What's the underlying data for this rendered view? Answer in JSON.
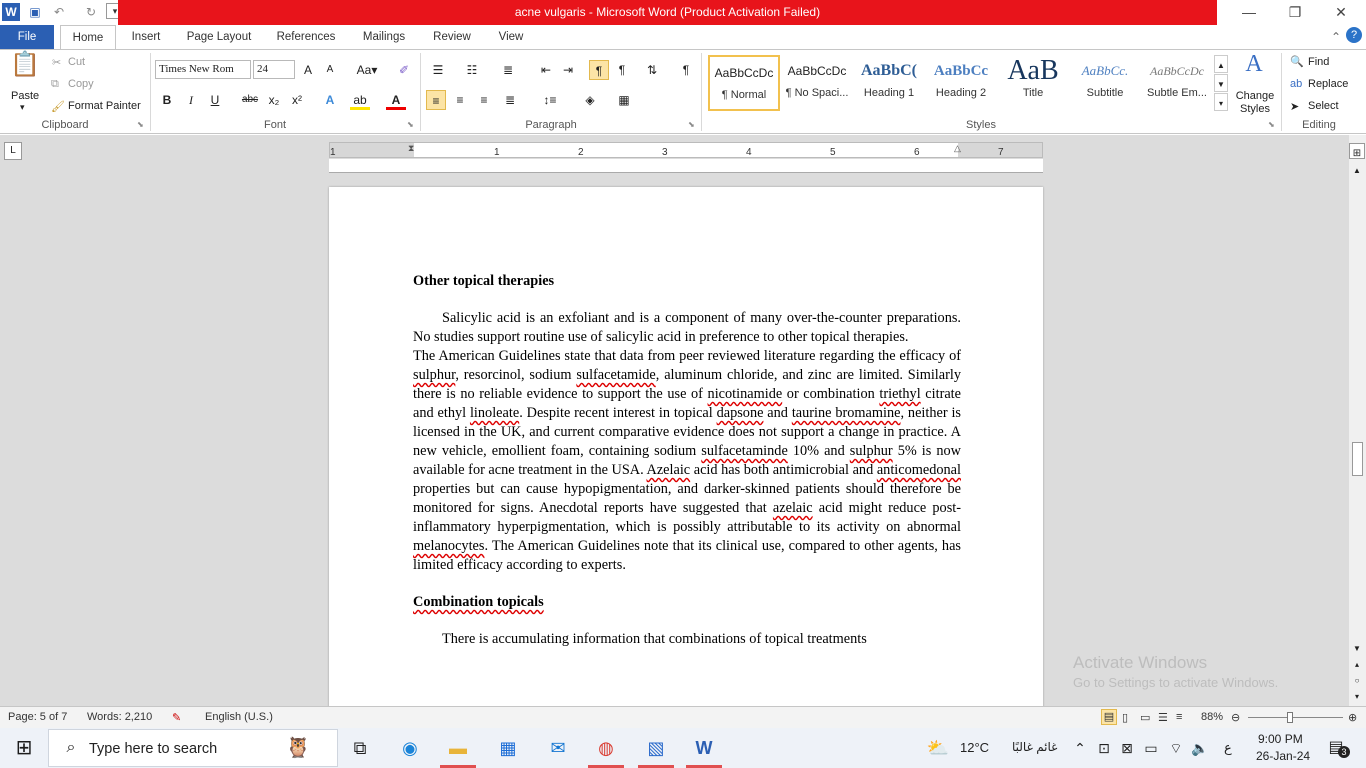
{
  "window": {
    "title": "acne vulgaris  -  Microsoft Word (Product Activation Failed)",
    "minimize": "—",
    "restore": "❐",
    "close": "✕"
  },
  "tabs": [
    "File",
    "Home",
    "Insert",
    "Page Layout",
    "References",
    "Mailings",
    "Review",
    "View"
  ],
  "clipboard": {
    "paste": "Paste",
    "cut": "Cut",
    "copy": "Copy",
    "format_painter": "Format Painter",
    "label": "Clipboard"
  },
  "font": {
    "family": "Times New Rom",
    "size": "24",
    "label": "Font"
  },
  "paragraph": {
    "label": "Paragraph"
  },
  "styles": {
    "label": "Styles",
    "items": [
      {
        "preview": "AaBbCcDc",
        "name": "¶ Normal"
      },
      {
        "preview": "AaBbCcDc",
        "name": "¶ No Spaci..."
      },
      {
        "preview": "AaBbC(",
        "name": "Heading 1"
      },
      {
        "preview": "AaBbCc",
        "name": "Heading 2"
      },
      {
        "preview": "AaB",
        "name": "Title"
      },
      {
        "preview": "AaBbCc.",
        "name": "Subtitle"
      },
      {
        "preview": "AaBbCcDc",
        "name": "Subtle Em..."
      }
    ],
    "change_styles": "Change Styles"
  },
  "editing": {
    "find": "Find",
    "replace": "Replace",
    "select": "Select",
    "label": "Editing"
  },
  "ruler": {
    "ticks": [
      "1",
      "1",
      "2",
      "3",
      "4",
      "5",
      "6",
      "7"
    ]
  },
  "document": {
    "heading1": "Other topical therapies",
    "p1": "Salicylic acid is an exfoliant and is a component of many over-the-counter preparations. No studies support routine use of salicylic acid in preference to other topical therapies.",
    "p2a": "The American Guidelines state that data from peer reviewed literature regarding the efficacy of ",
    "p2b": "sulphur",
    "p2c": ", resorcinol, sodium ",
    "p2d": "sulfacetamide",
    "p2e": ", aluminum chloride, and zinc are limited. Similarly there is no reliable evidence to support the use of ",
    "p2f": "nicotinamide",
    "p2g": " or combination ",
    "p2h": "triethyl",
    "p2i": " citrate and ethyl ",
    "p2j": "linoleate",
    "p2k": ". Despite recent interest in topical ",
    "p2l": "dapsone",
    "p2m": " and ",
    "p2n": "taurine bromamine",
    "p2o": ", neither is licensed in the UK, and current comparative evidence does not support a change in practice. A new vehicle, emollient foam, containing sodium ",
    "p2p": "sulfacetaminde",
    "p2q": " 10% and ",
    "p2r": "sulphur",
    "p2s": " 5% is now available for acne treatment in the USA. ",
    "p2t": "Azelaic",
    "p2u": " acid has both antimicrobial and ",
    "p2v": "anticomedonal",
    "p2w": " properties but can cause hypopigmentation, and darker-skinned patients should therefore be monitored for signs. Anecdotal reports have suggested that ",
    "p2x": "azelaic",
    "p2y": " acid might reduce post-inflammatory hyperpigmentation, which is possibly attributable to its activity on abnormal ",
    "p2z": "melanocytes",
    "p2end": ". The American Guidelines note that its clinical use, compared to other agents, has limited efficacy according to experts.",
    "heading2": "Combination topicals",
    "p3": "There is accumulating information that combinations of topical treatments"
  },
  "status": {
    "page": "Page: 5 of 7",
    "words": "Words: 2,210",
    "language": "English (U.S.)",
    "zoom": "88%"
  },
  "activation": {
    "title": "Activate Windows",
    "sub": "Go to Settings to activate Windows."
  },
  "taskbar": {
    "search_placeholder": "Type here to search",
    "weather_temp": "12°C",
    "weather_text": "غائم غالبًا",
    "lang": "ع",
    "time": "9:00 PM",
    "date": "26-Jan-24",
    "notifications": "3"
  },
  "colors": {
    "title_red": "#e8141b",
    "file_tab": "#2b5fb3"
  }
}
